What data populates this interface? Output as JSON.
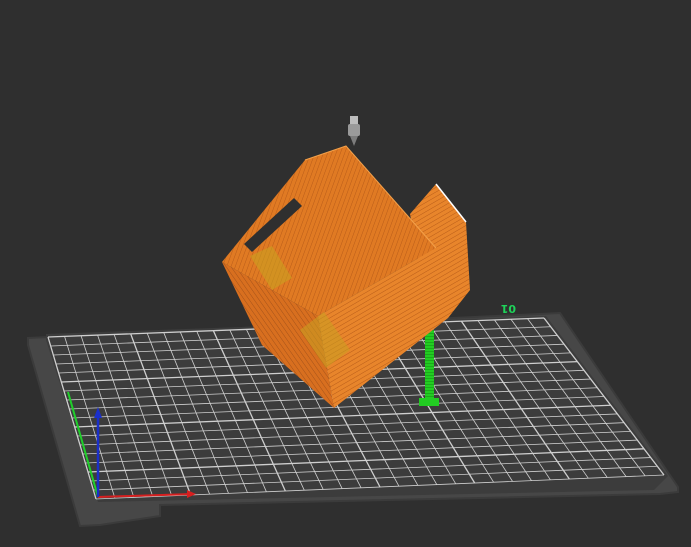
{
  "viewport": {
    "background": "#2f2f2f",
    "bed_label": "01",
    "bed_label_color": "#1fd35a",
    "plate_color": "#4a4a4a",
    "plate_edge_color": "#3a3a3a",
    "grid_color": "#cfcfcf",
    "model_color": "#e07a23",
    "model_shade_color": "#a4521a",
    "highlight_color": "#ffffff",
    "support_color": "#22cc22",
    "axis_colors": {
      "x": "#d61f1f",
      "y": "#1fcf2a",
      "z": "#1a2fc9"
    },
    "icons": {
      "nozzle": "extruder-nozzle-icon",
      "axes": "axis-gizmo-icon"
    }
  }
}
